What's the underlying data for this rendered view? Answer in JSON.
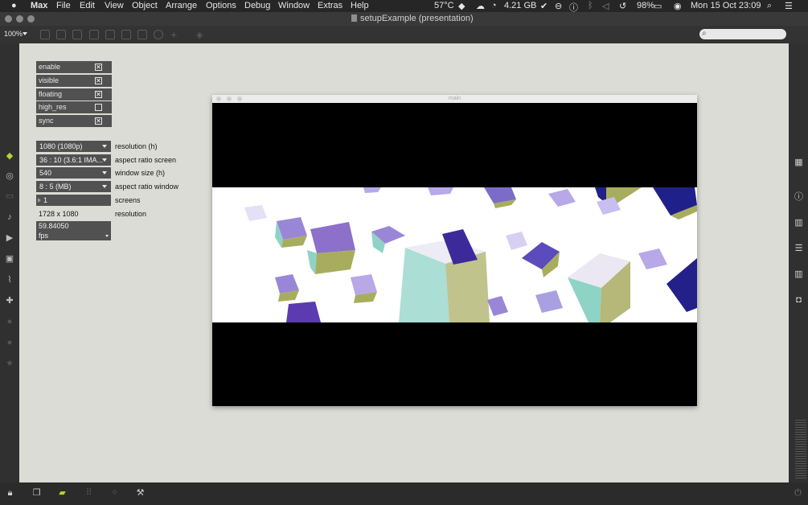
{
  "menubar": {
    "apple": "",
    "app_name": "Max",
    "items": [
      "File",
      "Edit",
      "View",
      "Object",
      "Arrange",
      "Options",
      "Debug",
      "Window",
      "Extras",
      "Help"
    ],
    "status": {
      "temp": "57°C",
      "storage": "4.21 GB",
      "battery": "98%",
      "datetime": "Mon 15 Oct  23:09"
    }
  },
  "window": {
    "title": "setupExample (presentation)"
  },
  "toolbar": {
    "zoom": "100%"
  },
  "toggles": [
    {
      "label": "enable",
      "checked": true
    },
    {
      "label": "visible",
      "checked": true
    },
    {
      "label": "floating",
      "checked": true
    },
    {
      "label": "high_res",
      "checked": false
    },
    {
      "label": "sync",
      "checked": true
    }
  ],
  "controls": {
    "resolution_menu": "1080 (1080p)",
    "resolution_label": "resolution (h)",
    "aspect_screen_menu": "36 : 10 (3.6:1 IMA...",
    "aspect_screen_label": "aspect ratio screen",
    "window_size_menu": "540",
    "window_size_label": "window size (h)",
    "aspect_window_menu": "8 : 5 (MB)",
    "aspect_window_label": "aspect ratio window",
    "screens_value": "1",
    "screens_label": "screens",
    "resolution_value": "1728 x 1080",
    "resolution_value_label": "resolution",
    "fps_value": "59.84050",
    "fps_unit": "fps"
  },
  "video_window": {
    "title": "main"
  },
  "colors": {
    "panel": "#515151",
    "canvas": "#dcdcd6",
    "accent_green": "#b5d334"
  }
}
